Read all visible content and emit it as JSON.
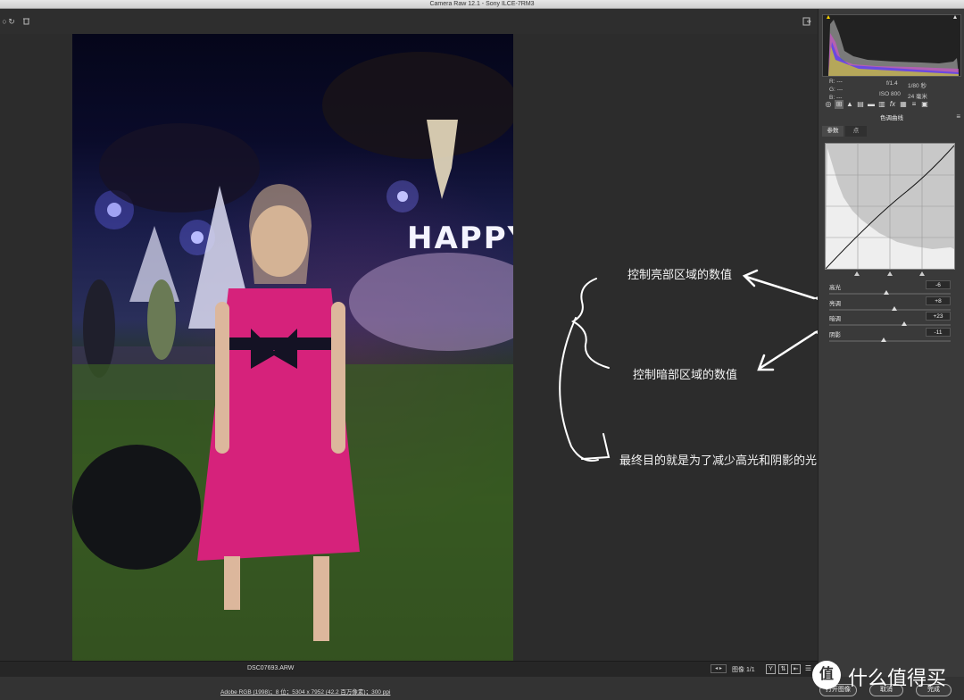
{
  "window": {
    "title": "Camera Raw 12.1 -  Sony ILCE-7RM3"
  },
  "toolbar": {
    "rotate_icon": "rotate-icon",
    "trash_icon": "trash-icon",
    "fullscreen_icon": "fullscreen-icon"
  },
  "exif": {
    "r_label": "R:",
    "g_label": "G:",
    "b_label": "B:",
    "r_value": "---",
    "g_value": "---",
    "b_value": "---",
    "aperture": "f/1.4",
    "shutter": "1/80 秒",
    "iso": "ISO 800",
    "focal": "24 毫米"
  },
  "panel": {
    "section_title": "色调曲线",
    "tabs": [
      {
        "label": "参数"
      },
      {
        "label": "点"
      }
    ],
    "sliders": [
      {
        "label": "高光",
        "value": "-6",
        "level": -6
      },
      {
        "label": "亮调",
        "value": "+8",
        "level": 8
      },
      {
        "label": "暗调",
        "value": "+23",
        "level": 23
      },
      {
        "label": "阴影",
        "value": "-11",
        "level": -11
      }
    ]
  },
  "annotations": {
    "highlights": "控制亮部区域的数值",
    "shadows": "控制暗部区域的数值",
    "goal": "最终目的就是为了减少高光和阴影的光比"
  },
  "status": {
    "filename": "DSC07693.ARW",
    "image_counter": "图像 1/1",
    "workflow": "Adobe RGB (1998)；8 位；5304 x 7952 (42.2 百万像素)；300 ppi"
  },
  "buttons": {
    "open": "打开图像",
    "cancel": "取消",
    "done": "完成"
  },
  "watermark": {
    "text": "什么值得买",
    "badge": "值"
  },
  "colors": {
    "accent": "#ffffff",
    "background": "#2b2b2b",
    "panel": "#3a3a3a"
  }
}
